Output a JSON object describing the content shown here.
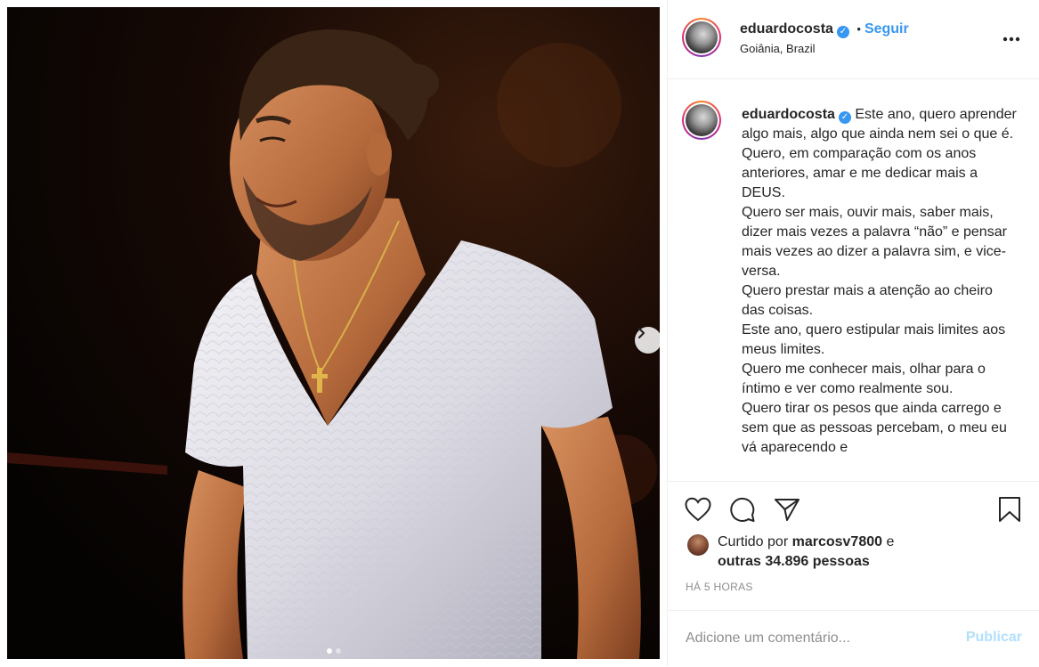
{
  "post": {
    "username": "eduardocosta",
    "verified_icon": "verified-badge-icon",
    "separator": "•",
    "follow_label": "Seguir",
    "location": "Goiânia, Brazil",
    "more_label": "•••",
    "caption": "Este ano, quero aprender algo mais, algo que ainda nem sei o que é.\nQuero, em comparação com os anos anteriores, amar e me dedicar mais a DEUS.\nQuero ser mais, ouvir mais, saber mais, dizer mais vezes a palavra “não” e pensar mais vezes ao dizer a palavra sim, e vice-versa.\nQuero prestar mais a atenção ao cheiro das coisas.\nEste ano, quero estipular mais limites aos meus limites.\nQuero me conhecer mais, olhar para o íntimo e ver como realmente sou.\nQuero tirar os pesos que ainda carrego e sem que as pessoas percebam, o meu eu vá aparecendo e",
    "likes": {
      "prefix": "Curtido por ",
      "liker": "marcosv7800",
      "connector": " e",
      "others": "outras 34.896 pessoas"
    },
    "timestamp": "HÁ 5 HORAS",
    "comment_placeholder": "Adicione um comentário...",
    "publish_label": "Publicar",
    "carousel": {
      "total": 2,
      "current": 1
    }
  },
  "colors": {
    "accent": "#3897f0",
    "publish_disabled": "#b2dffc",
    "muted": "#8e8e8e",
    "border": "#efefef"
  }
}
